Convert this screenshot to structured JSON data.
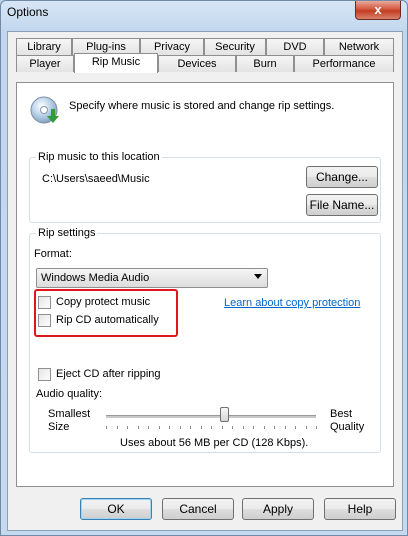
{
  "window": {
    "title": "Options",
    "close_glyph": "x"
  },
  "tabs_back": [
    "Library",
    "Plug-ins",
    "Privacy",
    "Security",
    "DVD",
    "Network"
  ],
  "tabs_front": [
    "Player",
    "Rip Music",
    "Devices",
    "Burn",
    "Performance"
  ],
  "active_tab": "Rip Music",
  "header": {
    "description": "Specify where music is stored and change rip settings.",
    "icon": "cd-rip-icon"
  },
  "rip_location": {
    "label": "Rip music to this location",
    "path": "C:\\Users\\saeed\\Music",
    "change_button": "Change...",
    "filename_button": "File Name..."
  },
  "rip_settings": {
    "label": "Rip settings",
    "format_label": "Format:",
    "format_value": "Windows Media Audio",
    "copy_protect_label": "Copy protect music",
    "copy_protect_checked": false,
    "rip_auto_label": "Rip CD automatically",
    "rip_auto_checked": false,
    "learn_link": "Learn about copy protection",
    "eject_label": "Eject CD after ripping",
    "eject_checked": false,
    "audio_quality_label": "Audio quality:",
    "smallest_line1": "Smallest",
    "smallest_line2": "Size",
    "best_line1": "Best",
    "best_line2": "Quality",
    "quality_fraction": 0.56,
    "usage_text": "Uses about 56 MB per CD (128 Kbps)."
  },
  "buttons": {
    "ok": "OK",
    "cancel": "Cancel",
    "apply": "Apply",
    "help": "Help"
  },
  "colors": {
    "highlight": "#e0161f",
    "link": "#0066cc"
  }
}
